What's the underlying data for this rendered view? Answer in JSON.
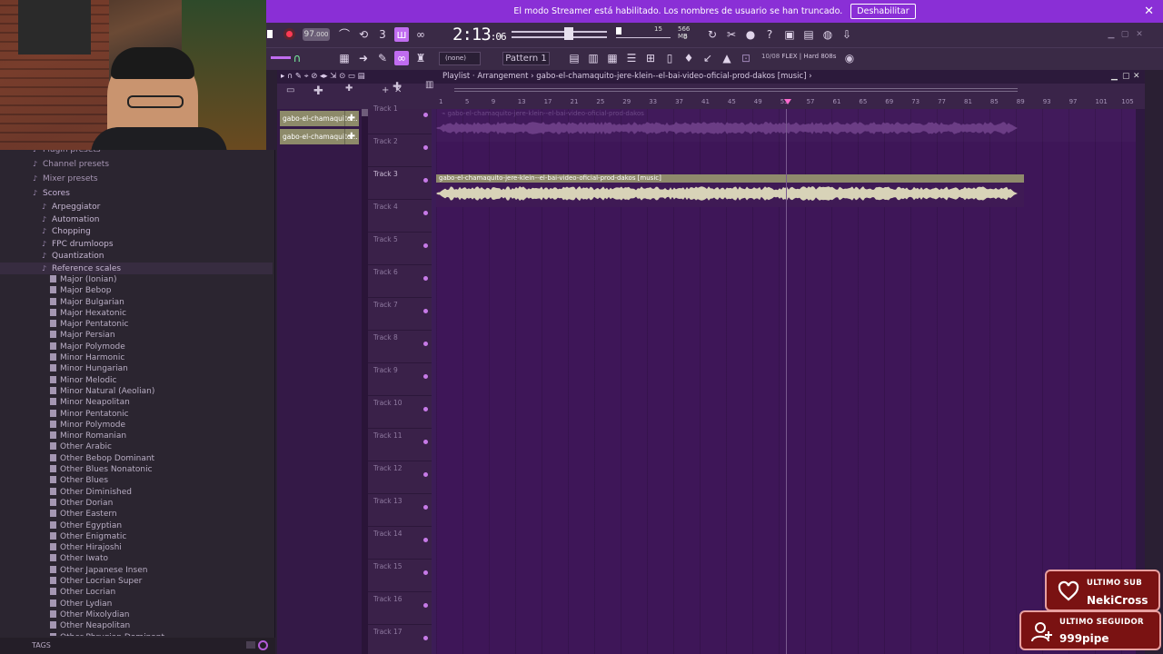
{
  "streamer_bar": {
    "message": "El modo Streamer está habilitado. Los nombres de usuario se han truncado.",
    "button": "Deshabilitar",
    "close": "✕"
  },
  "transport": {
    "tempo": "97",
    "tempo_decimal": ".000",
    "time_main": "2:13",
    "time_sub": ":06",
    "meter_value": "15",
    "memory": "566 MB",
    "cpu": "0"
  },
  "toolbar2": {
    "none_label": "(none)",
    "pattern_label": "Pattern 1",
    "flex_label": "10/08",
    "flex_preset": "FLEX | Hard 808s"
  },
  "browser": {
    "folders": [
      "Plugin presets",
      "Channel presets",
      "Mixer presets",
      "Scores"
    ],
    "subfolders": [
      "Arpeggiator",
      "Automation",
      "Chopping",
      "FPC drumloops",
      "Quantization",
      "Reference scales"
    ],
    "files": [
      "Major (Ionian)",
      "Major Bebop",
      "Major Bulgarian",
      "Major Hexatonic",
      "Major Pentatonic",
      "Major Persian",
      "Major Polymode",
      "Minor Harmonic",
      "Minor Hungarian",
      "Minor Melodic",
      "Minor Natural (Aeolian)",
      "Minor Neapolitan",
      "Minor Pentatonic",
      "Minor Polymode",
      "Minor Romanian",
      "Other Arabic",
      "Other Bebop Dominant",
      "Other Blues Nonatonic",
      "Other Blues",
      "Other Diminished",
      "Other Dorian",
      "Other Eastern",
      "Other Egyptian",
      "Other Enigmatic",
      "Other Hirajoshi",
      "Other Iwato",
      "Other Japanese Insen",
      "Other Locrian Super",
      "Other Locrian",
      "Other Lydian",
      "Other Mixolydian",
      "Other Neapolitan",
      "Other Phrygian Dominant"
    ],
    "tags_label": "TAGS"
  },
  "playlist": {
    "title": "Playlist · Arrangement › gabo-el-chamaquito-jere-klein--el-bai-video-oficial-prod-dakos [music] ›",
    "clips": [
      "gabo-el-chamaquito...",
      "gabo-el-chamaquito..."
    ],
    "region_label": "gabo-el-chamaquito-jere-klein--el-bai-video-oficial-prod-dakos [music]",
    "ghost_label": "⌁ gabo-el-chamaquito-jere-klein--el-bai-video-oficial-prod-dakos",
    "ruler": [
      "1",
      "5",
      "9",
      "13",
      "17",
      "21",
      "25",
      "29",
      "33",
      "37",
      "41",
      "45",
      "49",
      "53",
      "57",
      "61",
      "65",
      "69",
      "73",
      "77",
      "81",
      "85",
      "89",
      "93",
      "97",
      "101",
      "105"
    ],
    "tracks": [
      "Track 1",
      "Track 2",
      "Track 3",
      "Track 4",
      "Track 5",
      "Track 6",
      "Track 7",
      "Track 8",
      "Track 9",
      "Track 10",
      "Track 11",
      "Track 12",
      "Track 13",
      "Track 14",
      "Track 15",
      "Track 16",
      "Track 17"
    ]
  },
  "alerts": {
    "sub_title": "ULTIMO SUB",
    "sub_name": "NekiCross",
    "follower_title": "ULTIMO SEGUIDOR",
    "follower_name": "999pipe"
  },
  "colors": {
    "streamer_bar": "#8a2fd6",
    "playlist_bg": "#3e1658",
    "clip": "#8f8a6c",
    "alert_bg": "#7a1212",
    "accent": "#c06cf0"
  }
}
